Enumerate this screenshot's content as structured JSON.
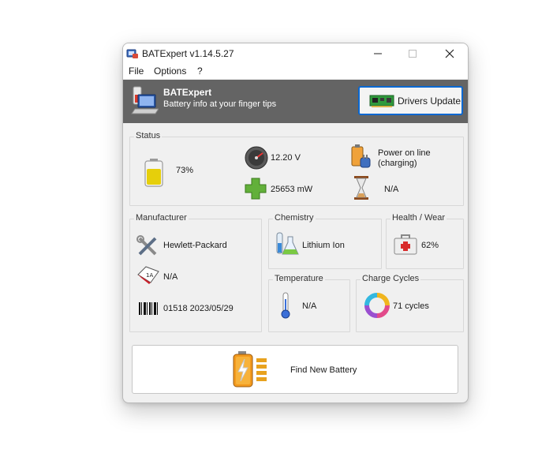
{
  "window": {
    "title": "BATExpert v1.14.5.27"
  },
  "menu": [
    "File",
    "Options",
    "?"
  ],
  "banner": {
    "app_name": "BATExpert",
    "tagline": "Battery info at your finger tips",
    "drivers_update_label": "Drivers Update"
  },
  "status": {
    "label": "Status",
    "charge_percent": "73%",
    "charge_level": 0.73,
    "voltage": "12.20 V",
    "power_source_line1": "Power on line",
    "power_source_line2": "(charging)",
    "power": "25653 mW",
    "time_remaining": "N/A"
  },
  "manufacturer": {
    "label": "Manufacturer",
    "name": "Hewlett-Packard",
    "model": "N/A",
    "serial_date": "01518 2023/05/29"
  },
  "chemistry": {
    "label": "Chemistry",
    "value": "Lithium Ion"
  },
  "health": {
    "label": "Health / Wear",
    "value": "62%"
  },
  "temperature": {
    "label": "Temperature",
    "value": "N/A"
  },
  "cycles": {
    "label": "Charge Cycles",
    "value": "71 cycles"
  },
  "find_battery": {
    "label": "Find New Battery"
  },
  "colors": {
    "banner_bg": "#646464",
    "accent_border": "#0a68d2",
    "window_bg": "#f0f0f0"
  }
}
